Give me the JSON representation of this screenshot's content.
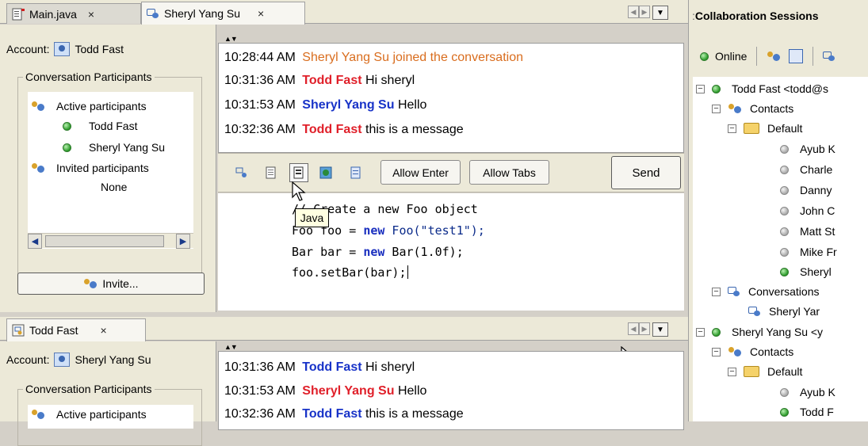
{
  "top_tabs": [
    {
      "label": "Main.java",
      "active": false
    },
    {
      "label": "Sheryl Yang Su",
      "active": true
    }
  ],
  "bottom_tabs": [
    {
      "label": "Todd Fast",
      "active": true
    }
  ],
  "tab_close_glyph": "×",
  "top_session": {
    "account_label": "Account:",
    "account_name": "Todd Fast",
    "participants_legend": "Conversation Participants",
    "active_label": "Active participants",
    "active": [
      "Todd Fast",
      "Sheryl Yang Su"
    ],
    "invited_label": "Invited participants",
    "invited_none": "None",
    "invite_button": "Invite...",
    "messages": [
      {
        "time": "10:28:44 AM",
        "who": "",
        "text": "Sheryl Yang Su joined the conversation",
        "style": "system"
      },
      {
        "time": "10:31:36 AM",
        "who": "Todd Fast",
        "text": "Hi sheryl",
        "style": "self"
      },
      {
        "time": "10:31:53 AM",
        "who": "Sheryl Yang Su",
        "text": "Hello",
        "style": "other"
      },
      {
        "time": "10:32:36 AM",
        "who": "Todd Fast",
        "text": "this is a message",
        "style": "self"
      }
    ],
    "toolbar": {
      "allow_enter": "Allow Enter",
      "allow_tabs": "Allow Tabs",
      "send": "Send",
      "tooltip": "Java"
    },
    "code_lines": [
      {
        "pre": "// Create a new Foo object",
        "kw": "",
        "post": ""
      },
      {
        "pre": "Foo foo = ",
        "kw": "new",
        "post": " Foo(\"test1\");"
      },
      {
        "pre": "Bar bar = ",
        "kw": "new",
        "post": " Bar(1.0f);"
      },
      {
        "pre": "foo.setBar(bar);",
        "kw": "",
        "post": ""
      }
    ]
  },
  "bottom_session": {
    "account_label": "Account:",
    "account_name": "Sheryl Yang Su",
    "participants_legend": "Conversation Participants",
    "active_label": "Active participants",
    "messages": [
      {
        "time": "10:31:36 AM",
        "who": "Todd Fast",
        "text": "Hi sheryl",
        "style": "other"
      },
      {
        "time": "10:31:53 AM",
        "who": "Sheryl Yang Su",
        "text": "Hello",
        "style": "self"
      },
      {
        "time": "10:32:36 AM",
        "who": "Todd Fast",
        "text": "this is a message",
        "style": "other"
      }
    ]
  },
  "collab": {
    "title": "Collaboration Sessions",
    "online_label": "Online",
    "tree": [
      {
        "label": "Todd Fast <todd@s",
        "kind": "account"
      },
      {
        "label": "Contacts",
        "kind": "contacts"
      },
      {
        "label": "Default",
        "kind": "folder"
      },
      {
        "label": "Ayub K",
        "kind": "contact",
        "online": false
      },
      {
        "label": "Charle",
        "kind": "contact",
        "online": false
      },
      {
        "label": "Danny",
        "kind": "contact",
        "online": false
      },
      {
        "label": "John C",
        "kind": "contact",
        "online": false
      },
      {
        "label": "Matt St",
        "kind": "contact",
        "online": false
      },
      {
        "label": "Mike Fr",
        "kind": "contact",
        "online": false
      },
      {
        "label": "Sheryl",
        "kind": "contact",
        "online": true
      },
      {
        "label": "Conversations",
        "kind": "conversations"
      },
      {
        "label": "Sheryl Yar",
        "kind": "conversation"
      },
      {
        "label": "Sheryl Yang Su <y",
        "kind": "account"
      },
      {
        "label": "Contacts",
        "kind": "contacts"
      },
      {
        "label": "Default",
        "kind": "folder"
      },
      {
        "label": "Ayub K",
        "kind": "contact",
        "online": false
      },
      {
        "label": "Todd F",
        "kind": "contact",
        "online": true
      }
    ]
  },
  "colors": {
    "self_name": "#e0202a",
    "other_name": "#1833c8",
    "system": "#d96d1e",
    "keyword": "#1a2fbf"
  }
}
